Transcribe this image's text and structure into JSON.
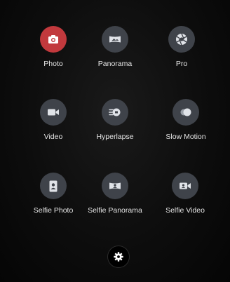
{
  "modes": [
    {
      "label": "Photo",
      "icon": "camera-icon",
      "active": true
    },
    {
      "label": "Panorama",
      "icon": "panorama-icon",
      "active": false
    },
    {
      "label": "Pro",
      "icon": "aperture-icon",
      "active": false
    },
    {
      "label": "Video",
      "icon": "video-camera-icon",
      "active": false
    },
    {
      "label": "Hyperlapse",
      "icon": "hyperlapse-icon",
      "active": false
    },
    {
      "label": "Slow Motion",
      "icon": "slow-motion-icon",
      "active": false
    },
    {
      "label": "Selfie Photo",
      "icon": "selfie-photo-icon",
      "active": false
    },
    {
      "label": "Selfie Panorama",
      "icon": "selfie-panorama-icon",
      "active": false
    },
    {
      "label": "Selfie Video",
      "icon": "selfie-video-icon",
      "active": false
    }
  ],
  "settings": {
    "icon": "gear-icon"
  },
  "colors": {
    "active": "#c2393d",
    "inactive": "#3f434a",
    "icon": "#e0e3e8",
    "label": "#e6e6e6",
    "background": "#0d0d0d"
  }
}
